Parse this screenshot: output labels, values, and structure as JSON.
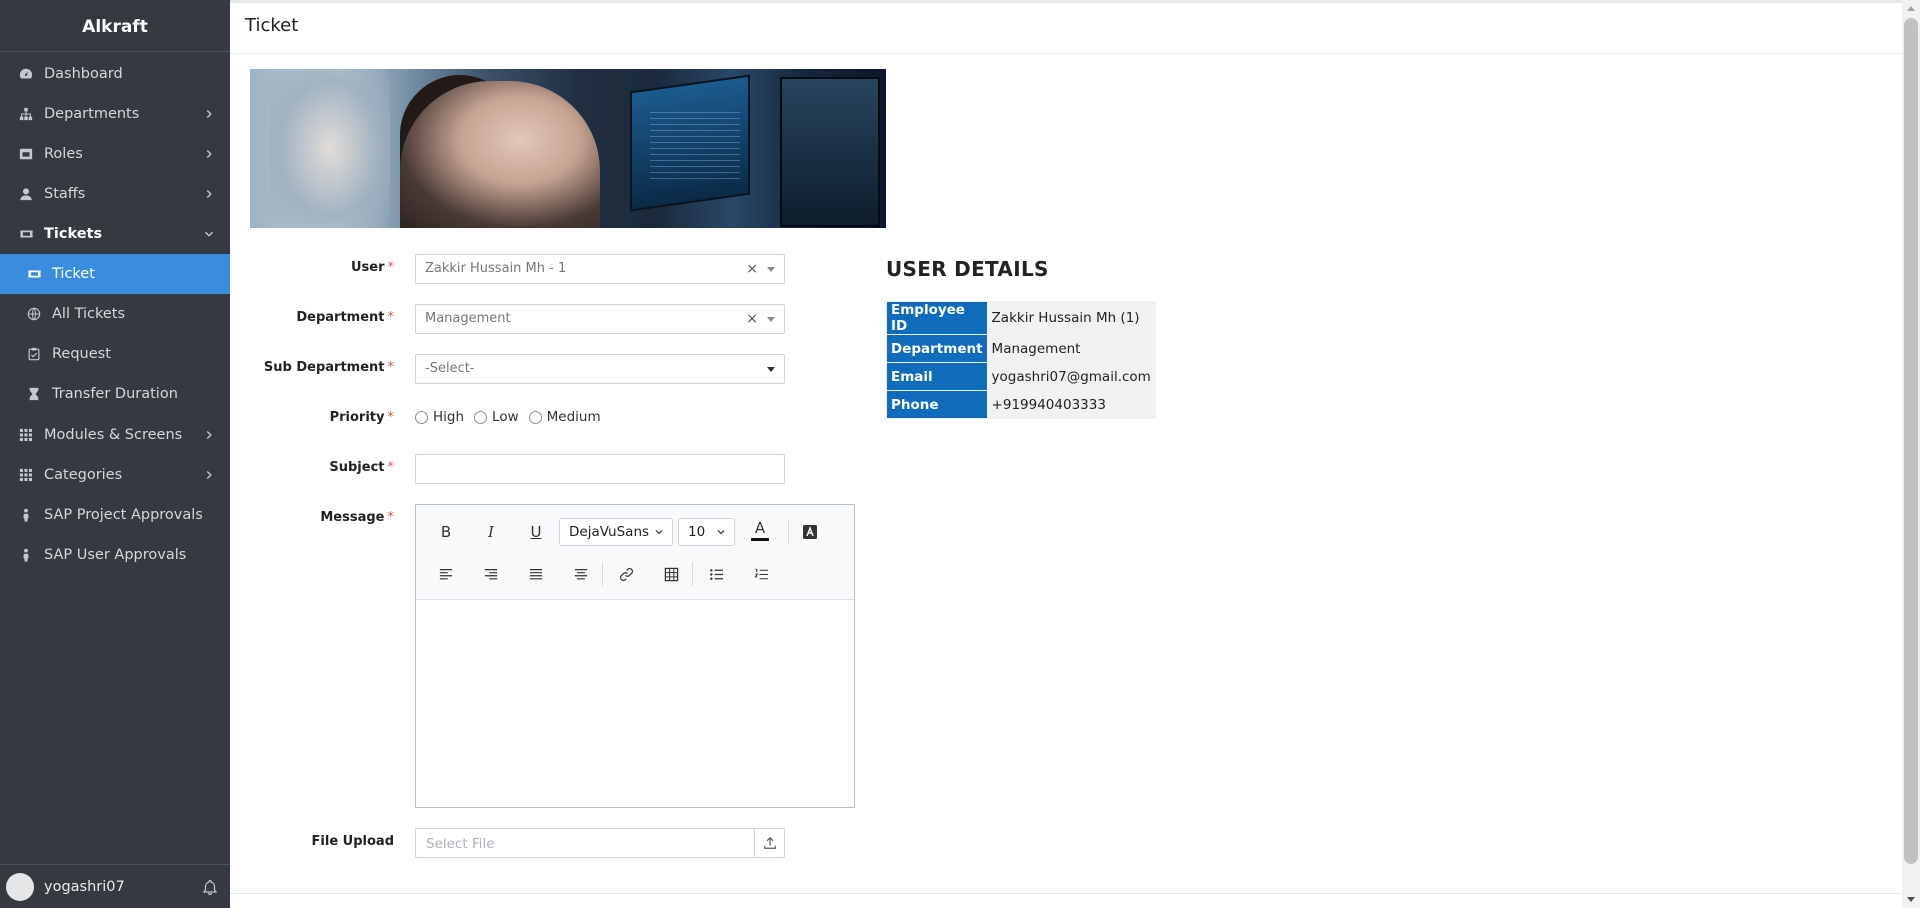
{
  "sidebar": {
    "brand": "Alkraft",
    "items": [
      {
        "label": "Dashboard",
        "icon": "dashboard-icon"
      },
      {
        "label": "Departments",
        "icon": "sitemap-icon"
      },
      {
        "label": "Roles",
        "icon": "roles-icon"
      },
      {
        "label": "Staffs",
        "icon": "user-icon"
      },
      {
        "label": "Tickets",
        "icon": "ticket-icon"
      },
      {
        "label": "Ticket",
        "icon": "ticket-icon"
      },
      {
        "label": "All Tickets",
        "icon": "globe-icon"
      },
      {
        "label": "Request",
        "icon": "clipboard-icon"
      },
      {
        "label": "Transfer Duration",
        "icon": "hourglass-icon"
      },
      {
        "label": "Modules & Screens",
        "icon": "grid-icon"
      },
      {
        "label": "Categories",
        "icon": "grid-icon"
      },
      {
        "label": "SAP Project Approvals",
        "icon": "person-icon"
      },
      {
        "label": "SAP User Approvals",
        "icon": "person-icon"
      }
    ],
    "footer": {
      "username": "yogashri07"
    }
  },
  "page": {
    "title": "Ticket"
  },
  "form": {
    "user_label": "User",
    "user_value": "Zakkir Hussain Mh - 1",
    "department_label": "Department",
    "department_value": "Management",
    "sub_department_label": "Sub Department",
    "sub_department_value": "-Select-",
    "priority_label": "Priority",
    "priority_options": [
      "High",
      "Low",
      "Medium"
    ],
    "subject_label": "Subject",
    "subject_value": "",
    "message_label": "Message",
    "file_upload_label": "File Upload",
    "file_upload_placeholder": "Select File",
    "required_mark": "*",
    "clear_mark": "×"
  },
  "editor": {
    "bold": "B",
    "italic": "I",
    "underline": "U",
    "font_family": "DejaVuSans",
    "font_size": "10",
    "font_color_glyph": "A"
  },
  "user_details": {
    "title": "USER DETAILS",
    "rows": [
      {
        "key": "Employee ID",
        "value": "Zakkir Hussain Mh (1)"
      },
      {
        "key": "Department",
        "value": "Management"
      },
      {
        "key": "Email",
        "value": "yogashri07@gmail.com"
      },
      {
        "key": "Phone",
        "value": "+919940403333"
      }
    ]
  },
  "colors": {
    "sidebar_bg": "#343a40",
    "active_item": "#3a8dde",
    "details_key_bg": "#0f6cbd",
    "required": "#d9534f"
  }
}
